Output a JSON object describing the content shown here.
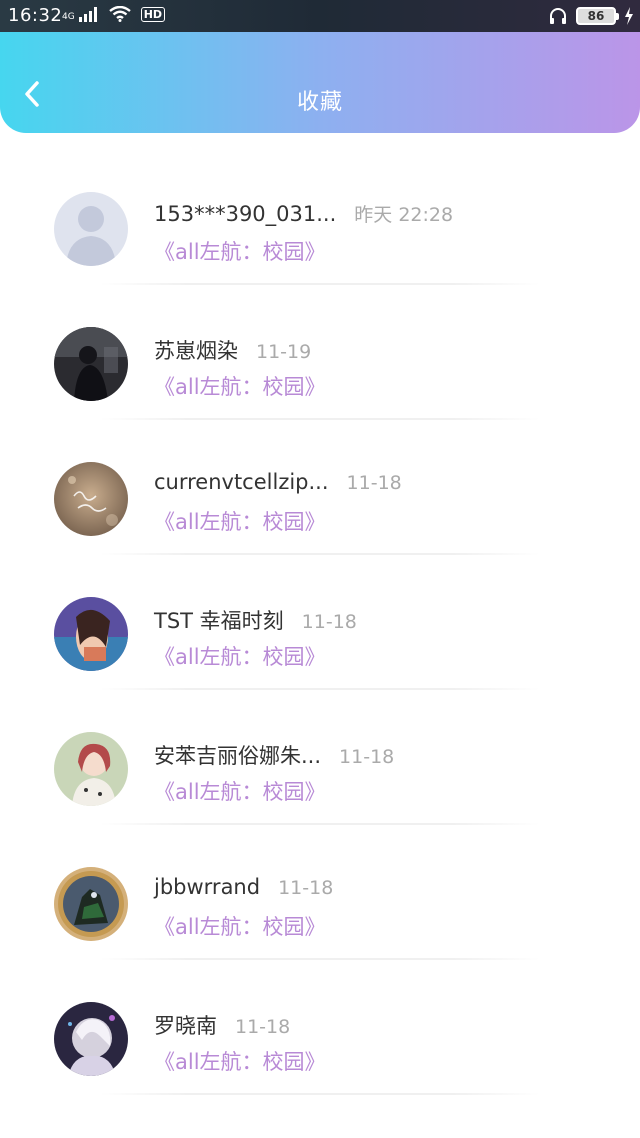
{
  "status_bar": {
    "time": "16:32",
    "network": "4G",
    "hd": "HD",
    "battery": "86"
  },
  "header": {
    "title": "收藏"
  },
  "items": [
    {
      "name": "153***390_031...",
      "time": "昨天 22:28",
      "work": "《all左航：校园》"
    },
    {
      "name": "苏崽烟染",
      "time": "11-19",
      "work": "《all左航：校园》"
    },
    {
      "name": "currenvtcellzip...",
      "time": "11-18",
      "work": "《all左航：校园》"
    },
    {
      "name": "TST 幸福时刻",
      "time": "11-18",
      "work": "《all左航：校园》"
    },
    {
      "name": "安苯吉丽俗娜朱...",
      "time": "11-18",
      "work": "《all左航：校园》"
    },
    {
      "name": "jbbwrrand",
      "time": "11-18",
      "work": "《all左航：校园》"
    },
    {
      "name": "罗晓南",
      "time": "11-18",
      "work": "《all左航：校园》"
    }
  ],
  "colors": {
    "header_gradient_start": "#46d6ef",
    "header_gradient_end": "#bb95e8",
    "work_title": "#b88ad6",
    "timestamp": "#aaaaaa"
  }
}
